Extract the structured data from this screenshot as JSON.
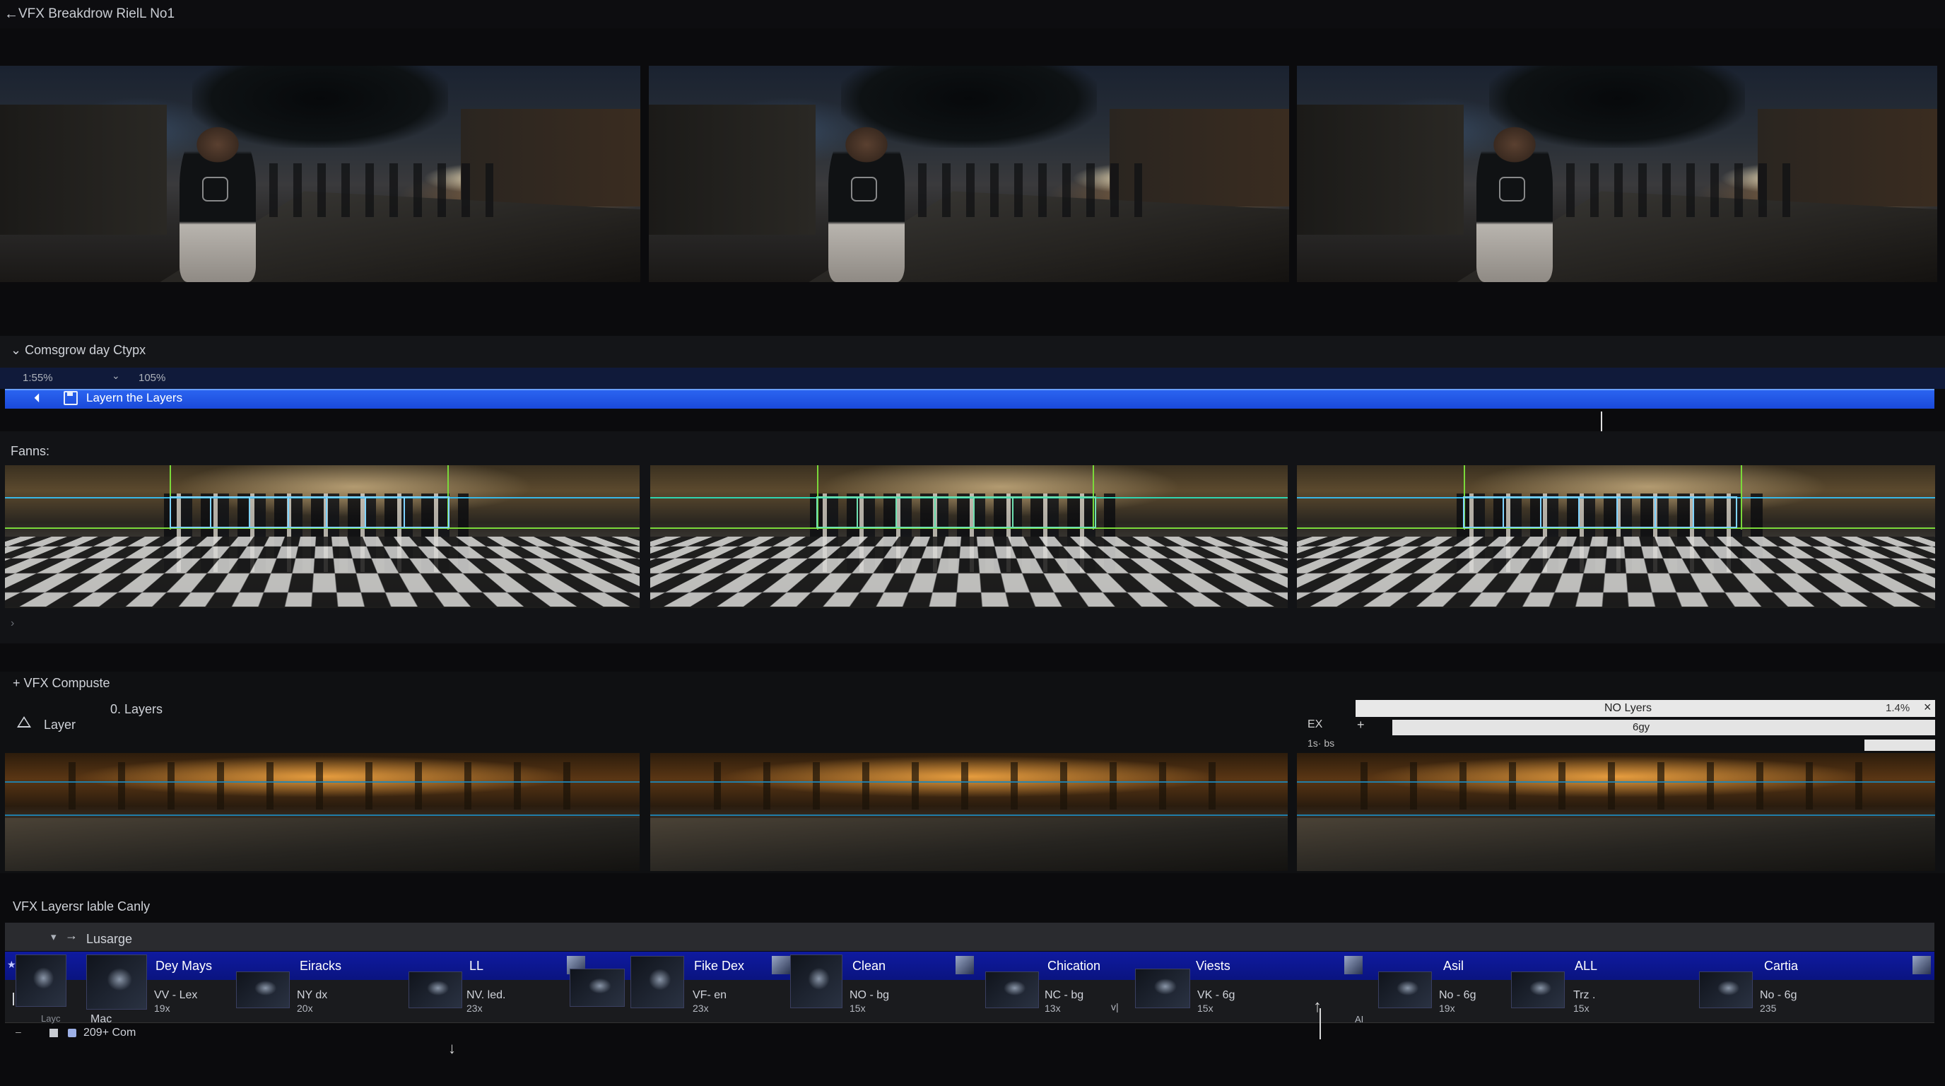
{
  "header": {
    "title": "VFX Breakdrow RielL No1",
    "back_icon": "arrow-left-icon"
  },
  "section1": {
    "label": "Comsgrow day Ctypx",
    "zoom_a": "1:55%",
    "zoom_b": "105%",
    "bar_label": "Layern the Layers"
  },
  "section2": {
    "label": "Fanns:"
  },
  "section3": {
    "label": "VFX Compuste",
    "layer_label": "Layer",
    "layers_count": "0. Layers",
    "overlay": {
      "title": "NO Lyers",
      "percent": "1.4%",
      "fx": "EX",
      "field": "6gy",
      "meta": "1s· bs"
    }
  },
  "table": {
    "label": "VFX Layersr lable Canly",
    "group_name": "Lusarge",
    "row2_small": "Layc",
    "row2_name": "Mac",
    "row3_text": "209+ Com",
    "ai_label": "AI",
    "columns": [
      {
        "name": "Dey Mays",
        "value": "VV - Lex",
        "count": "19x"
      },
      {
        "name": "Eiracks",
        "value": "NY dx",
        "count": "20x"
      },
      {
        "name": "LL",
        "value": "NV. led.",
        "count": "23x"
      },
      {
        "name": "Fike Dex",
        "value": "VF- en",
        "count": "23x"
      },
      {
        "name": "Clean",
        "value": "NO - bg",
        "count": "15x"
      },
      {
        "name": "Chication",
        "value": "NC - bg",
        "count": "13x"
      },
      {
        "name": "Viests",
        "value": "VK - 6g",
        "count": "15x"
      },
      {
        "name": "Asil",
        "value": "No - 6g",
        "count": "19x"
      },
      {
        "name": "ALL",
        "value": "Trz .",
        "count": "15x"
      },
      {
        "name": "Cartia",
        "value": "No - 6g",
        "count": "235"
      }
    ]
  },
  "colors": {
    "accent_blue": "#1a49d9",
    "table_strip": "#0f1aa0",
    "green_guide": "#7ad93a",
    "cyan_guide": "#38b7e6"
  }
}
